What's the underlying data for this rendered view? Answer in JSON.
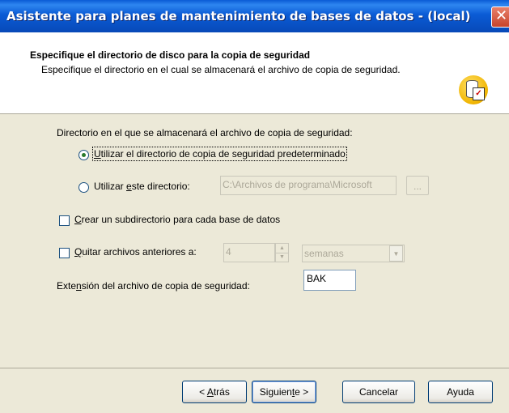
{
  "window": {
    "title": "Asistente para planes de mantenimiento de bases de datos - (local)"
  },
  "header": {
    "title": "Especifique el directorio de disco para la copia de seguridad",
    "description": "Especifique el directorio en el cual se almacenará el archivo de copia de seguridad."
  },
  "form": {
    "directory_label": "Directorio en el que se almacenará el archivo de copia de seguridad:",
    "radio_default": {
      "prefix": "",
      "key": "U",
      "rest": "tilizar el directorio de copia de seguridad predeterminado",
      "checked": true
    },
    "radio_custom": {
      "prefix": "Utilizar ",
      "key": "e",
      "rest": "ste directorio:",
      "checked": false
    },
    "custom_dir_value": "C:\\Archivos de programa\\Microsoft",
    "browse_label": "...",
    "subdir_checkbox": {
      "prefix": "",
      "key": "C",
      "rest": "rear un subdirectorio para cada base de datos",
      "checked": false
    },
    "remove_checkbox": {
      "prefix": "",
      "key": "Q",
      "rest": "uitar archivos anteriores a:",
      "checked": false
    },
    "remove_amount": "4",
    "remove_unit": "semanas",
    "extension_label": {
      "prefix": "Exte",
      "key": "n",
      "rest": "sión del archivo de copia de seguridad:"
    },
    "extension_value": "BAK"
  },
  "buttons": {
    "back": {
      "prefix": "< ",
      "key": "A",
      "rest": "trás"
    },
    "next": {
      "prefix": "Siguien",
      "key": "t",
      "rest": "e >"
    },
    "cancel": "Cancelar",
    "help": "Ayuda"
  }
}
